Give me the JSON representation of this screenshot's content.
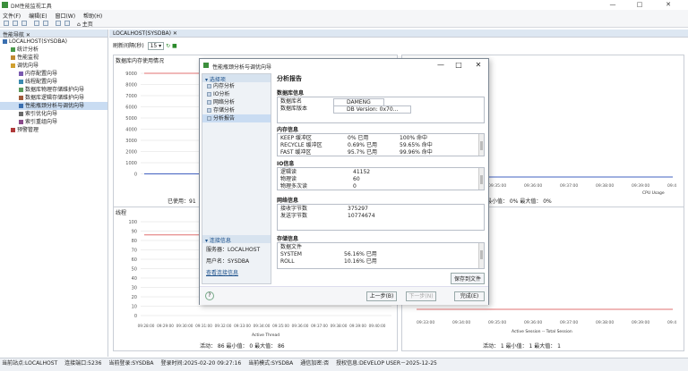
{
  "app": {
    "title": "DM性能监视工具"
  },
  "menu": [
    "文件(F)",
    "编辑(E)",
    "窗口(W)",
    "帮助(H)"
  ],
  "toolbar": {
    "home_label": "主页"
  },
  "left_panel": {
    "tab": "性能导航",
    "items": [
      {
        "label": "LOCALHOST(SYSDBA)",
        "indent": 0
      },
      {
        "label": "统计分析",
        "indent": 1
      },
      {
        "label": "性能监视",
        "indent": 1
      },
      {
        "label": "调优向导",
        "indent": 1
      },
      {
        "label": "内存配置向导",
        "indent": 2
      },
      {
        "label": "线程配置向导",
        "indent": 2
      },
      {
        "label": "数据库物理存储维护向导",
        "indent": 2
      },
      {
        "label": "数据库逻辑存储维护向导",
        "indent": 2
      },
      {
        "label": "性能瓶颈分析与调优向导",
        "indent": 2,
        "selected": true
      },
      {
        "label": "索引优化向导",
        "indent": 2
      },
      {
        "label": "索引重组向导",
        "indent": 2
      },
      {
        "label": "预警管理",
        "indent": 1
      }
    ]
  },
  "workspace": {
    "tab": "LOCALHOST(SYSDBA)",
    "refresh_label": "刷新间隔(秒)",
    "refresh_value": "15",
    "mem_chart_title": "数据库内存使用情况",
    "mem_used_label": "已使用：91",
    "cpu_status": "最小值： 0%  最大值： 0%",
    "cpu_legend": "CPU Usage",
    "thread_chart_title": "线程",
    "thread_status": "活动：  86   最小值：  0   最大值：  86",
    "thread_legend": "Active Thread",
    "session_legend": "Active Session -- Total Session",
    "session_status": "活动：  1   最小值：  1   最大值：  1"
  },
  "mem_chart": {
    "y_ticks": [
      "9000",
      "8000",
      "7000",
      "6000",
      "5000",
      "4000",
      "3000",
      "2000",
      "1000",
      "0"
    ]
  },
  "thread_chart": {
    "y_ticks": [
      "100",
      "90",
      "80",
      "70",
      "60",
      "50",
      "40",
      "30",
      "20",
      "10",
      "0"
    ],
    "x_ticks": [
      "09:28:00",
      "09:29:00",
      "09:30:00",
      "09:31:00",
      "09:32:00",
      "09:33:00",
      "09:34:00",
      "09:35:00",
      "09:36:00",
      "09:37:00",
      "09:38:00",
      "09:39:00",
      "09:40:00"
    ]
  },
  "right_x_ticks": [
    "09:33:00",
    "09:34:00",
    "09:35:00",
    "09:36:00",
    "09:37:00",
    "09:38:00",
    "09:39:00",
    "09:40:00"
  ],
  "dialog": {
    "title": "性能瓶颈分析与调优向导",
    "left_section": "选择项",
    "steps": [
      "内存分析",
      "IO分析",
      "网络分析",
      "存储分析",
      "分析报告"
    ],
    "conn_section": "连接信息",
    "server": "服务器：LOCALHOST",
    "user": "用户名：SYSDBA",
    "conn_link": "查看连接信息",
    "report_title": "分析报告",
    "db_info_title": "数据库信息",
    "db_rows": [
      {
        "k": "数据库名",
        "v": "DAMENG"
      },
      {
        "k": "数据库版本",
        "v": "DB Version: 0x70..."
      }
    ],
    "mem_info_title": "内存信息",
    "mem_rows": [
      {
        "k": "KEEP 缓冲区",
        "a": "0% 已用",
        "b": "100% 命中"
      },
      {
        "k": "RECYCLE 缓冲区",
        "a": "0.69% 已用",
        "b": "59.65% 命中"
      },
      {
        "k": "FAST 缓冲区",
        "a": "95.7% 已用",
        "b": "99.96% 命中"
      }
    ],
    "io_info_title": "IO信息",
    "io_rows": [
      {
        "k": "逻辑读",
        "v": "41152"
      },
      {
        "k": "物理读",
        "v": "60"
      },
      {
        "k": "物理多次读",
        "v": "0"
      }
    ],
    "net_info_title": "网络信息",
    "net_rows": [
      {
        "k": "接收字节数",
        "v": "375297"
      },
      {
        "k": "发送字节数",
        "v": "10774674"
      }
    ],
    "store_info_title": "存储信息",
    "store_rows": [
      {
        "k": "数据文件",
        "v": ""
      },
      {
        "k": "SYSTEM",
        "v": "56.16% 已用"
      },
      {
        "k": "ROLL",
        "v": "10.16% 已用"
      }
    ],
    "save_label": "保存到文件",
    "prev_label": "上一步(B)",
    "next_label": "下一步(N)",
    "finish_label": "完成(E)",
    "help_label": "?"
  },
  "statusbar": [
    "当前站点:LOCALHOST",
    "连接端口:5236",
    "当前登录:SYSDBA",
    "登录时间:2025-02-20 09:27:16",
    "当前模式:SYSDBA",
    "通信加密:否",
    "授权信息:DEVELOP USER－2025-12-25"
  ],
  "colors": {
    "accent": "#1a4f8a",
    "selection": "#c9dcf2",
    "red_line": "#e07070",
    "blue_line": "#4060c0"
  }
}
